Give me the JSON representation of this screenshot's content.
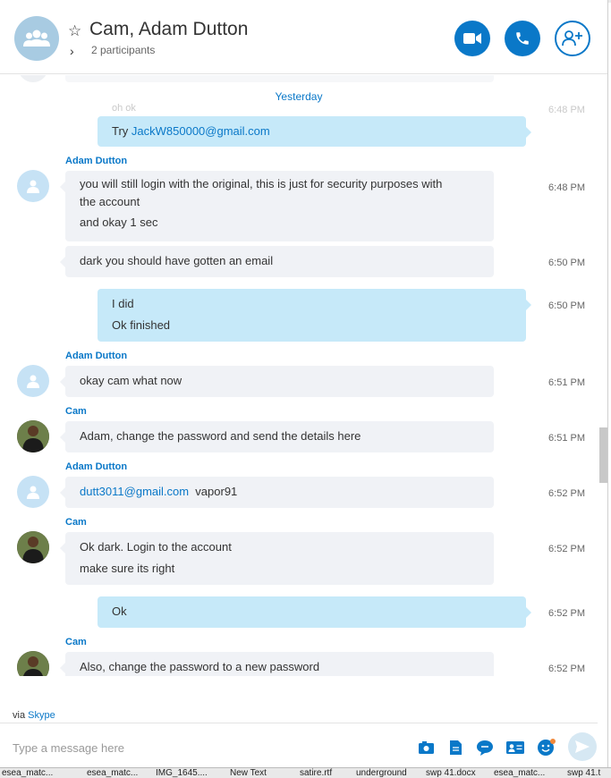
{
  "header": {
    "title": "Cam, Adam Dutton",
    "participants": "2 participants"
  },
  "messages": {
    "faded_text": "oh ok",
    "faded_time": "6:48 PM",
    "date_divider": "Yesterday",
    "m1": {
      "prefix": "Try ",
      "link": "JackW850000@gmail.com"
    },
    "m2": {
      "sender": "Adam Dutton",
      "line1": "you will still login with the original,  this is just for security purposes with",
      "line2": "the account",
      "line3": "and okay 1 sec",
      "time": "6:48 PM"
    },
    "m3": {
      "text": "dark you should have gotten an email",
      "time": "6:50 PM"
    },
    "m4": {
      "line1": "I did",
      "line2": "Ok finished",
      "time": "6:50 PM"
    },
    "m5": {
      "sender": "Adam Dutton",
      "text": "okay cam  what now",
      "time": "6:51 PM"
    },
    "m6": {
      "sender": "Cam",
      "text": "Adam, change the password and send the details here",
      "time": "6:51 PM"
    },
    "m7": {
      "sender": "Adam Dutton",
      "link": "dutt3011@gmail.com",
      "suffix": "  vapor91",
      "time": "6:52 PM"
    },
    "m8": {
      "sender": "Cam",
      "line1": "Ok dark. Login to the account",
      "line2": "make sure its right",
      "time": "6:52 PM"
    },
    "m9": {
      "text": "Ok",
      "time": "6:52 PM"
    },
    "m10": {
      "sender": "Cam",
      "text": "Also, change the password to a new password",
      "time": "6:52 PM"
    }
  },
  "footer": {
    "via_prefix": "via ",
    "via_link": "Skype",
    "compose_placeholder": "Type a message here"
  },
  "taskbar": [
    "esea_matc...",
    "esea_matc...",
    "IMG_1645....",
    "New Text",
    "satire.rtf",
    "underground",
    "swp 41.docx",
    "esea_matc...",
    "swp 41.t"
  ],
  "colors": {
    "accent": "#0a78c8",
    "incoming_bubble": "#f0f2f6",
    "outgoing_bubble": "#c6e9f9"
  }
}
